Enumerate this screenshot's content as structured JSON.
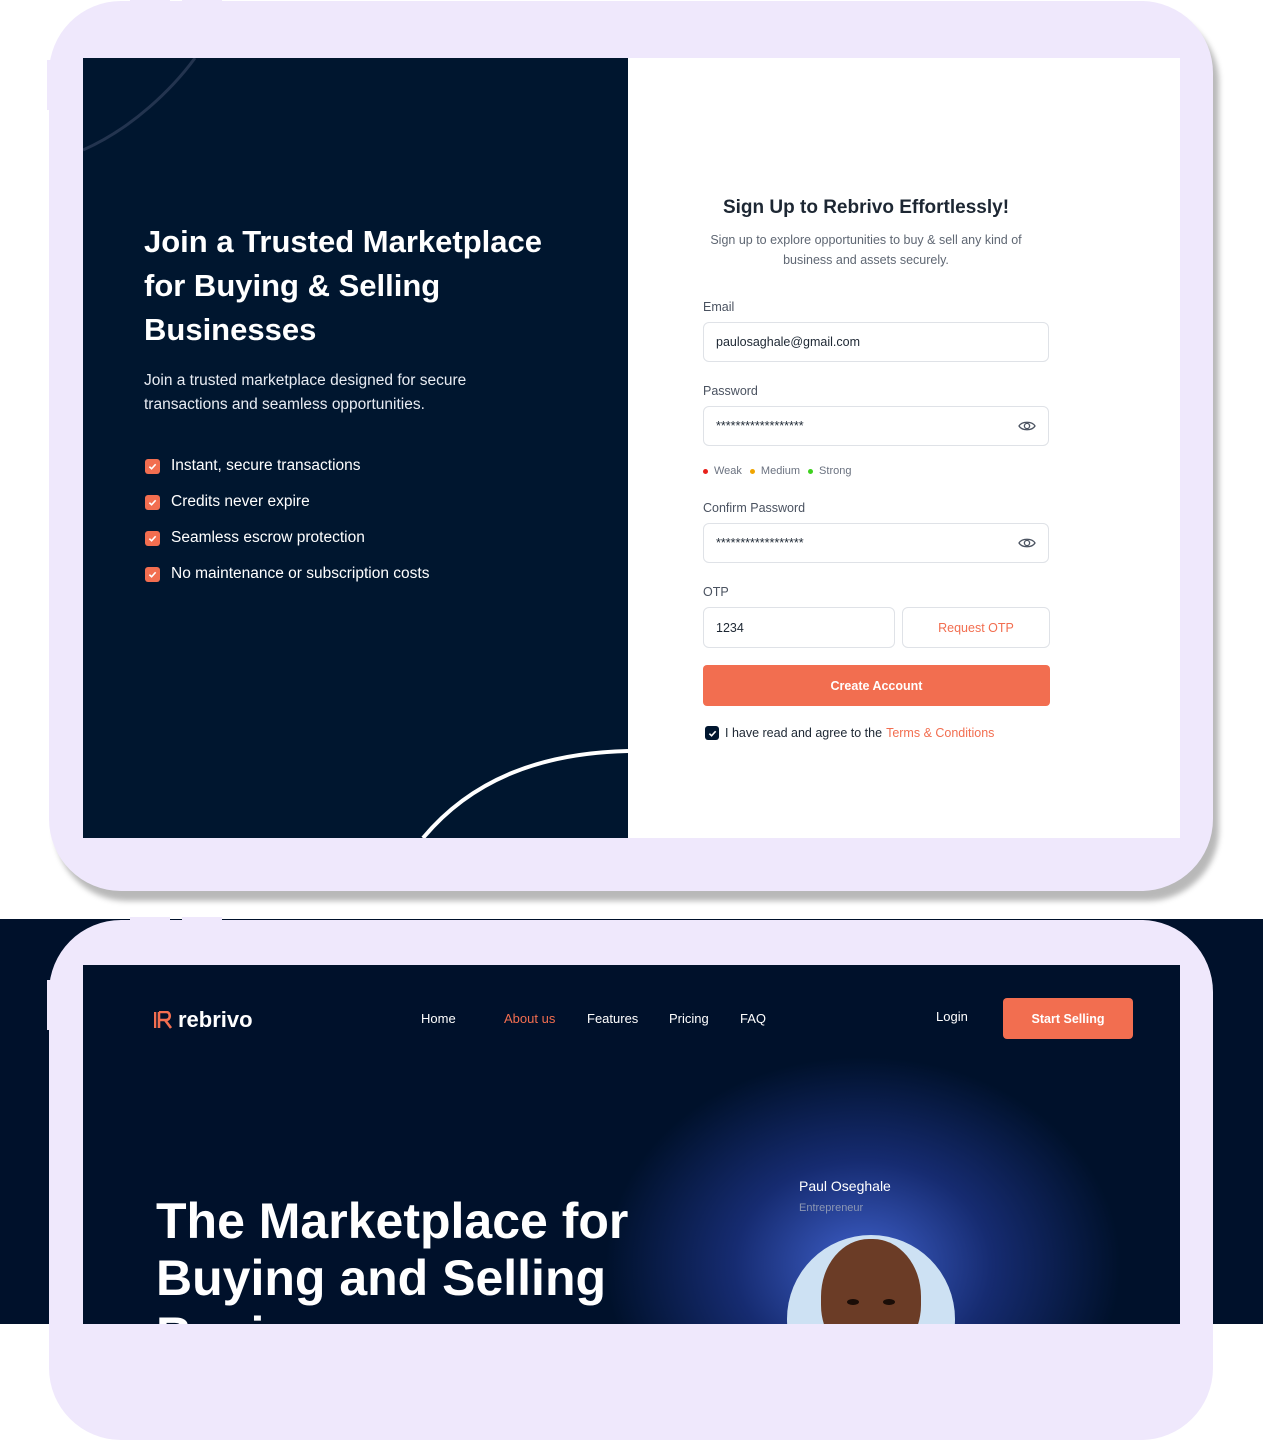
{
  "signup": {
    "left": {
      "headline": "Join a Trusted Marketplace for Buying & Selling Businesses",
      "subtitle": "Join a trusted marketplace designed for secure transactions and seamless opportunities.",
      "features": [
        "Instant, secure transactions",
        "Credits never expire",
        "Seamless escrow protection",
        "No maintenance or subscription costs"
      ]
    },
    "form": {
      "title": "Sign Up to Rebrivo Effortlessly!",
      "subtitle": "Sign up to explore opportunities to buy & sell any kind of business and assets securely.",
      "email_label": "Email",
      "email_value": "paulosaghale@gmail.com",
      "password_label": "Password",
      "password_value": "******************",
      "strength": [
        "Weak",
        "Medium",
        "Strong"
      ],
      "strength_colors": [
        "#e8201a",
        "#f0a500",
        "#3ed11e"
      ],
      "confirm_label": "Confirm Password",
      "confirm_value": "******************",
      "otp_label": "OTP",
      "otp_value": "1234",
      "request_otp": "Request OTP",
      "create_button": "Create Account",
      "agree_text": "I have read and agree to the",
      "terms_link": "Terms & Conditions"
    }
  },
  "landing": {
    "logo_text": "rebrivo",
    "nav": [
      "Home",
      "About us",
      "Features",
      "Pricing",
      "FAQ"
    ],
    "nav_active": "About us",
    "login": "Login",
    "start_selling": "Start Selling",
    "headline": "The Marketplace for Buying and Selling Businesses",
    "person_name": "Paul Oseghale",
    "person_role": "Entrepreneur"
  },
  "colors": {
    "accent": "#f26e50",
    "navy": "#00162f",
    "frame": "#efe8fc"
  }
}
